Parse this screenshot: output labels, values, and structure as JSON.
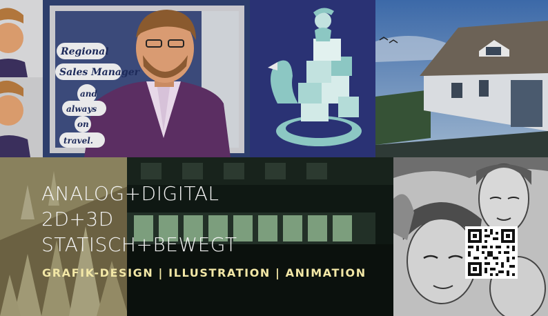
{
  "poster": {
    "headline": [
      "ANALOG+DIGITAL",
      "2D+3D",
      "STATISCH+BEWEGT"
    ],
    "subheadline": "GRAFIK-DESIGN | ILLUSTRATION | ANIMATION"
  },
  "sales_tile": {
    "bubble_lines": [
      "Regional",
      "Sales Manager",
      "and",
      "always",
      "on",
      "travel."
    ]
  },
  "colors": {
    "headline": "#f4f4f4",
    "subheadline": "#f2e7a6",
    "navy": "#2a3274",
    "sky": "#3f6aa6"
  },
  "icons": {
    "qr": "qr-code-icon"
  }
}
